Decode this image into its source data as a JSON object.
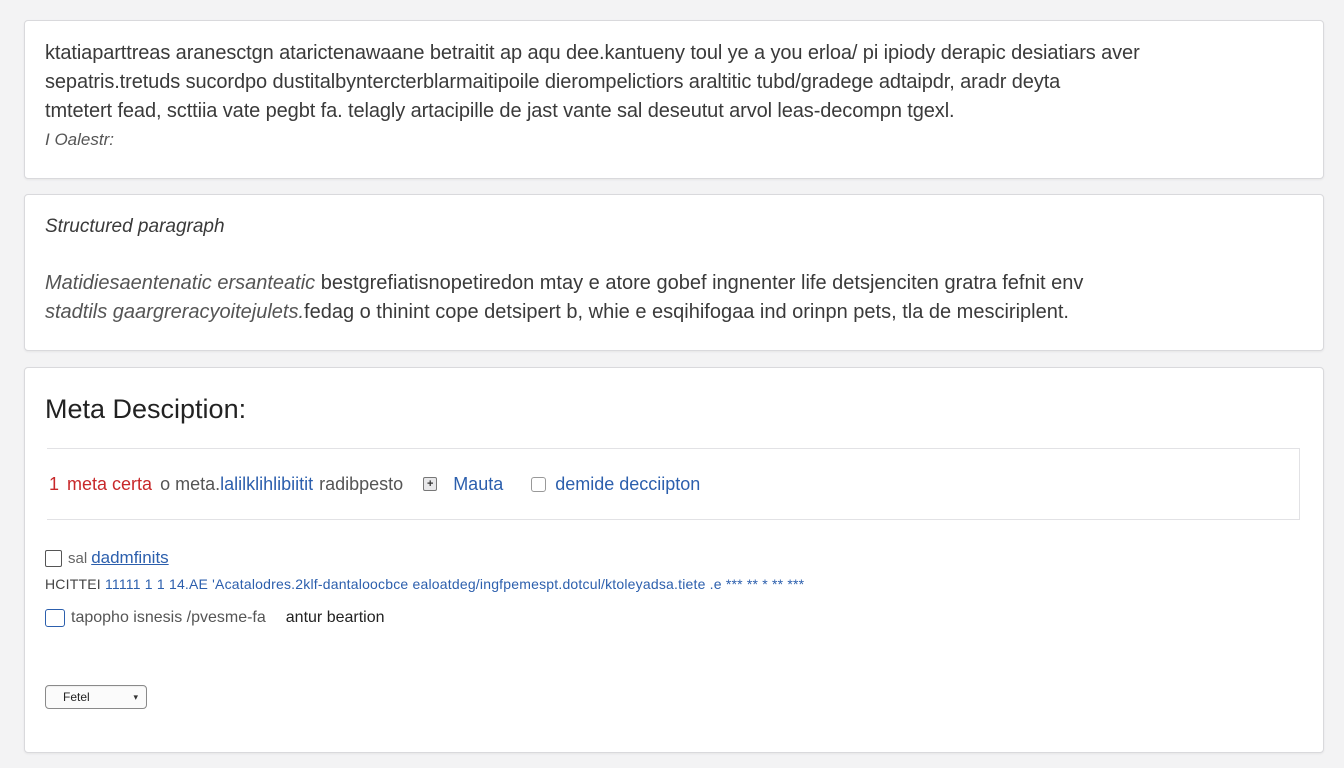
{
  "intro": {
    "lines": [
      "ktatiaparttreas aranesctgn atarictenawaane betraitit ap aqu dee.kantueny toul ye a you erloa/ pi ipiody derapic desiatiars aver",
      "sepatris.tretuds sucordpo dustitalbyntercterblarmaitipoile dierompelictiors araltitic tubd/gradege adtaipdr, aradr deyta",
      "tmtetert fead, scttiia vate pegbt fa. telagly artacipille de jast vante sal deseutut arvol leas-decompn tgexl."
    ],
    "note": "I Oalestr:"
  },
  "paragraph": {
    "heading": "Structured paragraph",
    "lines": [
      {
        "lead": "Matidiesaentenatic ersanteatic",
        "rest": " bestgrefiatisnopetiredon mtay e atore gobef ingnenter life detsjenciten gratra fefnit env"
      },
      {
        "lead": "stadtils gaargreracyoitejulets.",
        "rest": "fedag o thinint cope detsipert b, whie e esqihifogaa ind orinpn pets, tla de mesciriplent."
      }
    ]
  },
  "meta": {
    "title": "Meta Desciption:",
    "count": "1",
    "field_label": "meta certa",
    "field_desc": "o meta.",
    "field_blur": "lalilklihlibiitit",
    "field_tail": "radibpesto",
    "plus_glyph": "+",
    "tag_label": "Mauta",
    "check_label": "demide decciipton",
    "option1_prefix": "sal",
    "option1_link": "dadmfinits",
    "url_grey": "HCITTEI",
    "url_blue": "11111 1 1 14.AE 'Acatalodres.2klf-dantaloocbce ealoatdeg/ingfpemespt.dotcul/ktoleyadsa.tiete .e *** ** * ** ***",
    "option2_grey": "tapopho isnesis /pvesme-fa",
    "option2_dark": "antur beartion",
    "select_value": "Fetel"
  },
  "colors": {
    "accent_red": "#c8282a",
    "link_blue": "#2c5fad",
    "page_bg": "#f3f3f4"
  }
}
